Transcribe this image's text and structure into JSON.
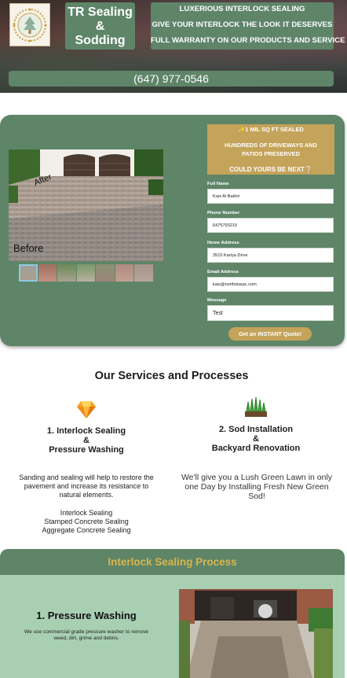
{
  "header": {
    "brand_line1": "TR Sealing",
    "brand_line2": "&",
    "brand_line3": "Sodding",
    "promo": [
      "LUXERIOUS INTERLOCK SEALING",
      "GIVE YOUR INTERLOCK THE LOOK IT DESERVES",
      "FULL WARRANTY ON OUR PRODUCTS AND SERVICE"
    ],
    "phone": "(647) 977-0546",
    "logo_icon": "tree-seal-logo-icon"
  },
  "gallery": {
    "after_label": "After",
    "before_label": "Before",
    "thumbnail_count": 7
  },
  "form": {
    "banner_line1": "✨1 MIL SQ FT SEALED",
    "banner_line2": "HUNDREDS OF DRIVEWAYS AND",
    "banner_line3": "PATIOS PRESERVED",
    "banner_line4": "COULD YOURS BE NEXT❔",
    "fields": {
      "full_name": {
        "label": "Full Name",
        "value": "Kais Al Bakhri"
      },
      "phone": {
        "label": "Phone Number",
        "value": "6475793215"
      },
      "address": {
        "label": "Home Address",
        "value": "3515 Kariya Drive"
      },
      "email": {
        "label": "Email Address",
        "value": "kais@northstarpc.com"
      },
      "message": {
        "label": "Message",
        "value": "Test"
      }
    },
    "submit_label": "Get an INSTANT Quote!"
  },
  "services": {
    "title": "Our Services and Processes",
    "items": [
      {
        "icon": "gem-icon",
        "title_line1": "1.  Interlock Sealing",
        "title_line2": "&",
        "title_line3": "Pressure Washing",
        "desc_line1": "Sanding and sealing will help to restore the",
        "desc_line2": "pavement and increase its resistance to",
        "desc_line3": "natural elements.",
        "list": [
          "Interlock Sealing",
          "Stamped Concrete Sealing",
          "Aggregate Concrete Sealing"
        ]
      },
      {
        "icon": "grass-icon",
        "title_line1": "2. Sod Installation",
        "title_line2": "&",
        "title_line3": "Backyard Renovation",
        "desc_line1": "We'll give you a Lush Green Lawn in only",
        "desc_line2": "one Day by Installing Fresh New Green",
        "desc_line3": "Sod!"
      }
    ]
  },
  "process": {
    "title": "Interlock Sealing Process",
    "step_title": "1. Pressure Washing",
    "step_text_line1": "We use commercial grade pressure washer to remove",
    "step_text_line2": "weed, dirt, grime and debris."
  },
  "colors": {
    "green": "#5e8567",
    "gold": "#c4a35a",
    "light_green": "#a8cfb2"
  }
}
